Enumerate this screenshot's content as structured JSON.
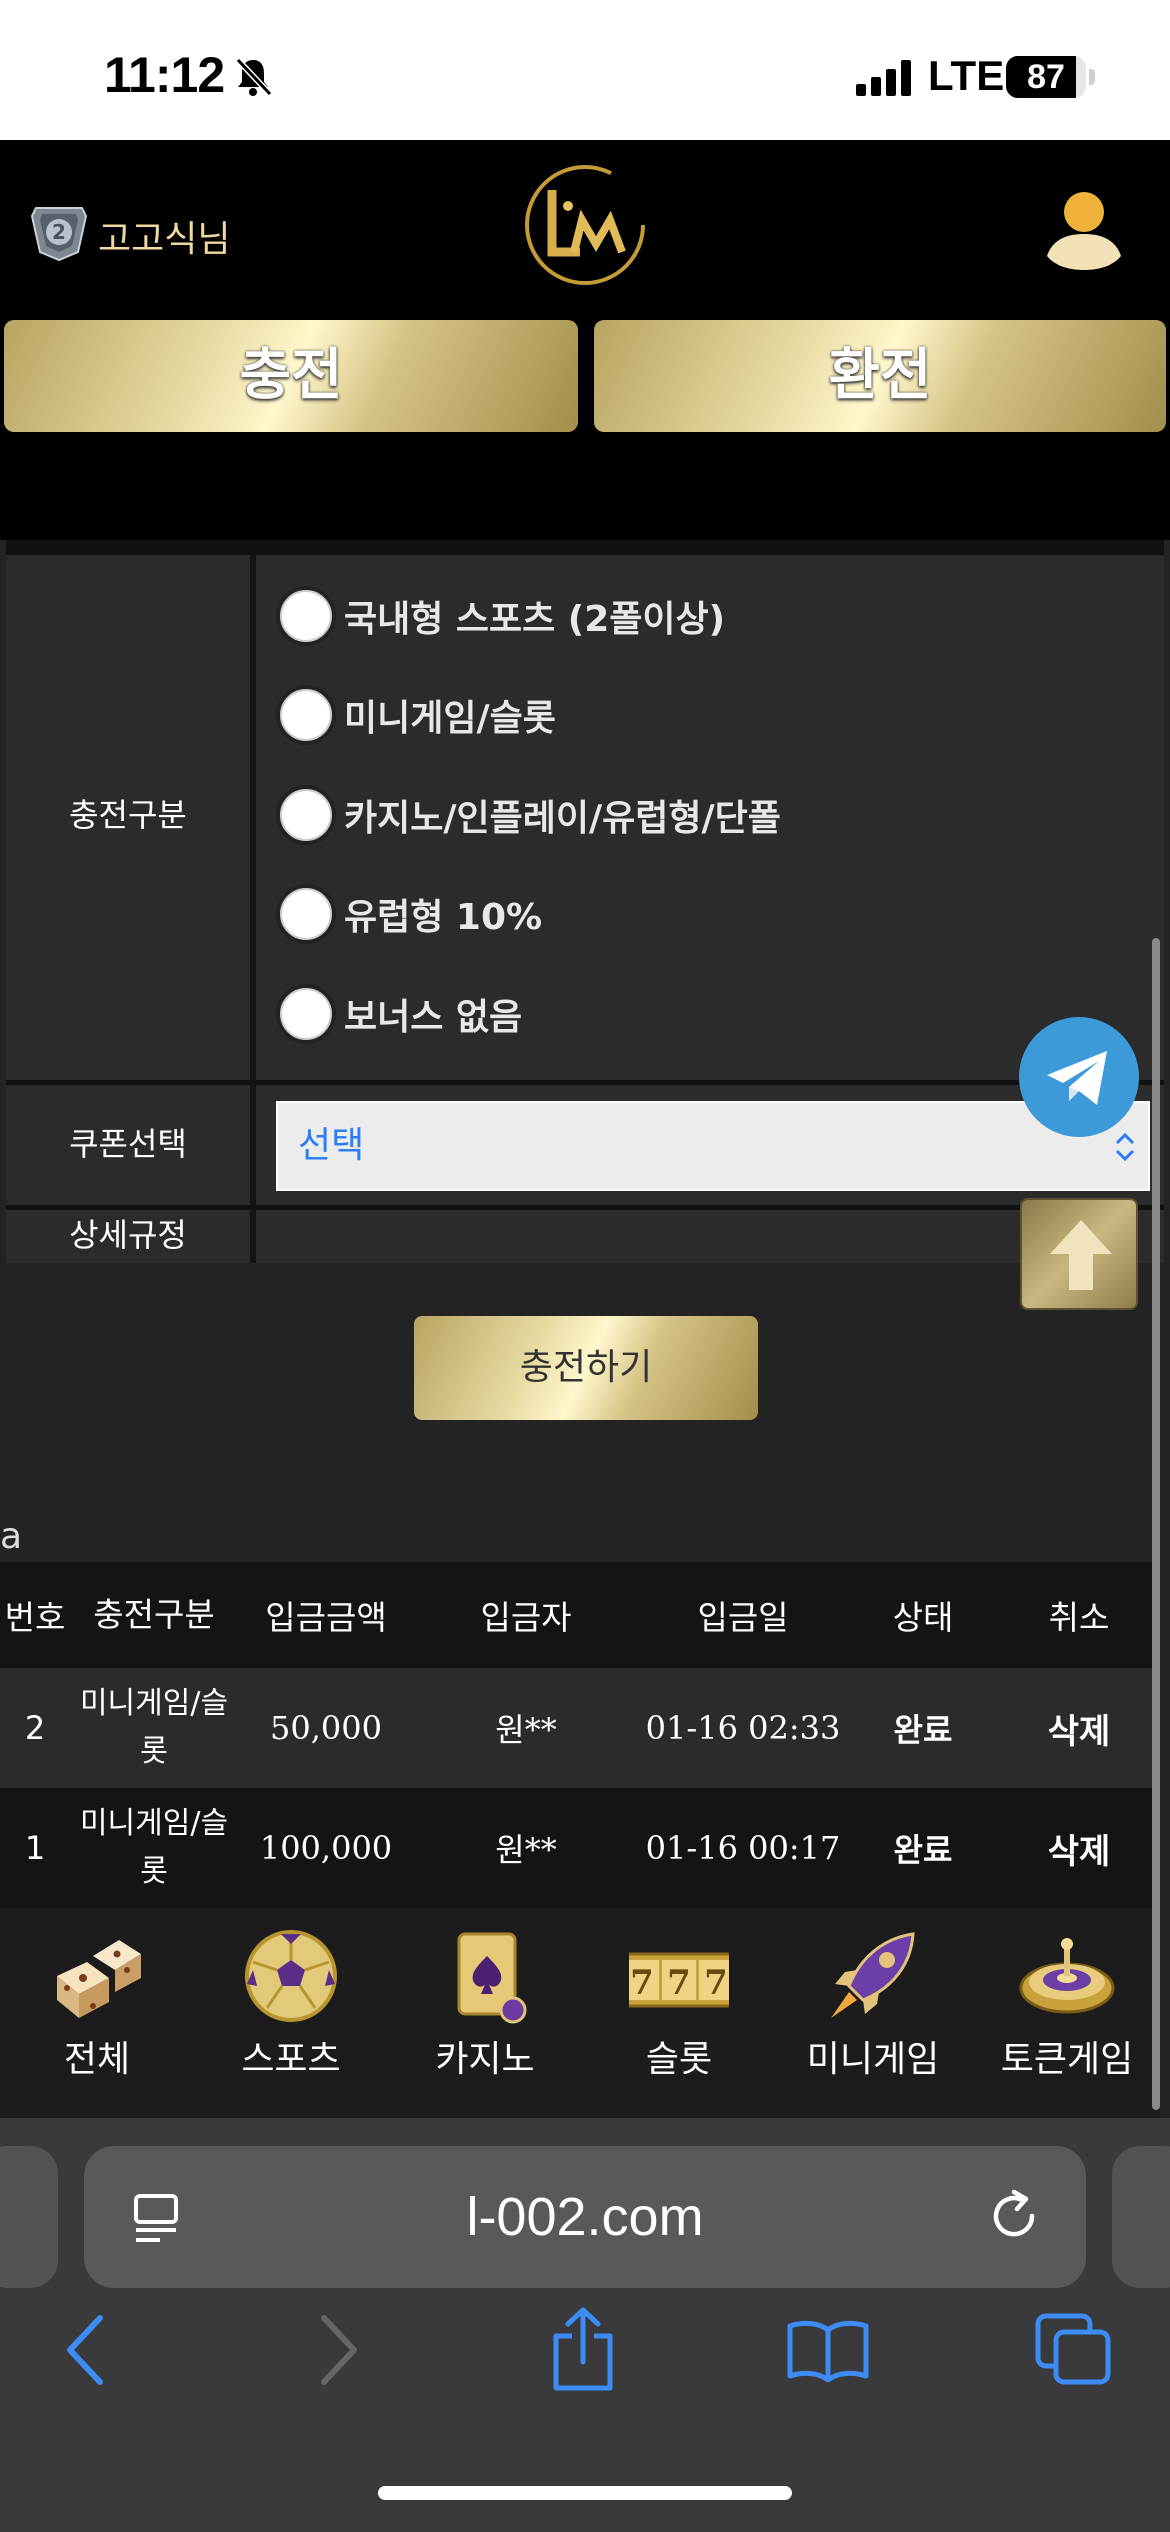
{
  "status_bar": {
    "time": "11:12",
    "network": "LTE",
    "battery": "87",
    "battery_level": 0.87
  },
  "header": {
    "user_name": "고고식님",
    "rank_icon": "rank-2-badge-icon",
    "logo": "lim-logo",
    "profile_icon": "user-profile-icon",
    "tabs": [
      {
        "label": "충전"
      },
      {
        "label": "환전"
      }
    ]
  },
  "form": {
    "category_label": "충전구분",
    "options": [
      {
        "label": "국내형 스포츠 (2폴이상)"
      },
      {
        "label": "미니게임/슬롯"
      },
      {
        "label": "카지노/인플레이/유럽형/단폴"
      },
      {
        "label": "유럽형 10%"
      },
      {
        "label": "보너스 없음"
      }
    ],
    "coupon_label": "쿠폰선택",
    "coupon_value": "선택",
    "rules_label": "상세규정",
    "submit_label": "충전하기"
  },
  "stray_text": "a",
  "history": {
    "headers": [
      "번호",
      "충전구분",
      "입금금액",
      "입금자",
      "입금일",
      "상태",
      "취소"
    ],
    "rows": [
      {
        "no": "2",
        "category_line1": "미니게임/슬",
        "category_line2": "롯",
        "amount": "50,000",
        "depositor": "원**",
        "date": "01-16 02:33",
        "status": "완료",
        "cancel": "삭제"
      },
      {
        "no": "1",
        "category_line1": "미니게임/슬",
        "category_line2": "롯",
        "amount": "100,000",
        "depositor": "원**",
        "date": "01-16 00:17",
        "status": "완료",
        "cancel": "삭제"
      }
    ]
  },
  "game_nav": [
    {
      "label": "전체",
      "icon": "dice-icon"
    },
    {
      "label": "스포츠",
      "icon": "soccer-ball-icon"
    },
    {
      "label": "카지노",
      "icon": "playing-card-icon"
    },
    {
      "label": "슬롯",
      "icon": "slot-777-icon"
    },
    {
      "label": "미니게임",
      "icon": "rocket-icon"
    },
    {
      "label": "토큰게임",
      "icon": "roulette-icon"
    }
  ],
  "browser": {
    "url": "l-002.com"
  },
  "colors": {
    "gold": "#d8c98a",
    "telegram": "#3d9ad9",
    "link_blue": "#2d7df6",
    "background": "#232323"
  }
}
